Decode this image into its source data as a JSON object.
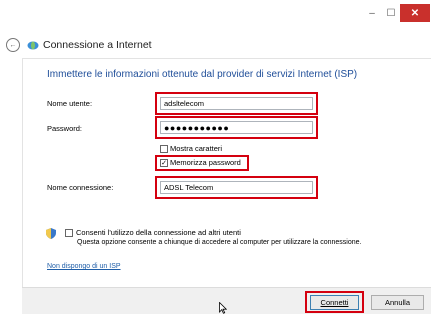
{
  "window": {
    "minimize": "–",
    "maximize": "☐",
    "close": "✕"
  },
  "header": {
    "title": "Connessione a Internet"
  },
  "form": {
    "subtitle": "Immettere le informazioni ottenute dal provider di servizi Internet (ISP)",
    "username_label": "Nome utente:",
    "username_value": "adsltelecom",
    "password_label": "Password:",
    "password_value": "●●●●●●●●●●●",
    "show_chars_label": "Mostra caratteri",
    "show_chars_checked": false,
    "remember_label": "Memorizza password",
    "remember_checked": true,
    "connection_name_label": "Nome connessione:",
    "connection_name_value": "ADSL Telecom",
    "allow_others_label": "Consenti l'utilizzo della connessione ad altri utenti",
    "allow_others_checked": false,
    "allow_others_desc": "Questa opzione consente a chiunque di accedere al computer per utilizzare la connessione.",
    "no_isp_link": "Non dispongo di un ISP"
  },
  "buttons": {
    "connect": "Connetti",
    "cancel": "Annulla"
  },
  "colors": {
    "accent": "#1f4e99",
    "highlight": "#d4000f",
    "close": "#c9302c"
  }
}
